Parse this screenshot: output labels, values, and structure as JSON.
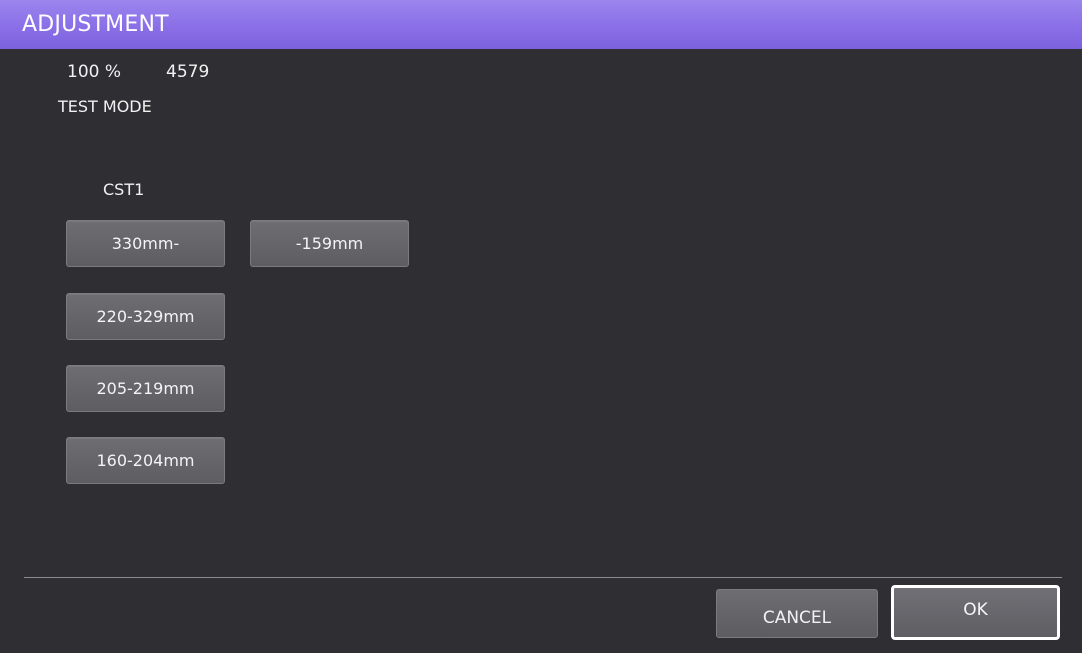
{
  "title": "ADJUSTMENT",
  "status": {
    "percent": "100 %",
    "count": "4579",
    "mode": "TEST MODE"
  },
  "cassette": {
    "label": "CST1",
    "sizes": [
      "330mm-",
      "-159mm",
      "220-329mm",
      "205-219mm",
      "160-204mm"
    ]
  },
  "footer": {
    "cancel_label": "CANCEL",
    "ok_label": "OK"
  },
  "colors": {
    "title_bar": "#8a6fe7",
    "background": "#2f2f33",
    "button": "#656569",
    "ok_border": "#ffffff"
  }
}
